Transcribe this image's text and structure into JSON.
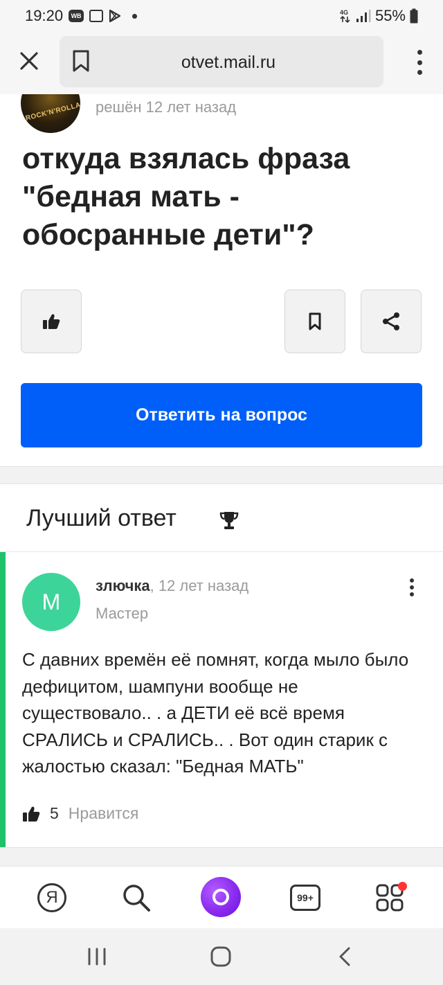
{
  "status_bar": {
    "time": "19:20",
    "wb_label": "WB",
    "battery": "55%",
    "icons": [
      "wb-app-icon",
      "gallery-icon",
      "play-store-icon",
      "notification-dot-icon",
      "network-4g-icon",
      "signal-icon",
      "battery-icon"
    ]
  },
  "browser": {
    "url": "otvet.mail.ru",
    "icons": [
      "close-icon",
      "bookmark-icon",
      "more-vertical-icon"
    ]
  },
  "question": {
    "status": "решён 12 лет назад",
    "title": "откуда взялась фраза \"бедная мать - обосранные дети\"?",
    "avatar_text": "ROCK'N'ROLLA",
    "answer_button": "Ответить на вопрос",
    "icons": [
      "thumbs-up-icon",
      "bookmark-icon",
      "share-icon"
    ]
  },
  "best_answer": {
    "heading": "Лучший ответ",
    "avatar_letter": "М",
    "author": "злючка",
    "time": ", 12 лет назад",
    "rank": "Мастер",
    "text": "С давних времён её помнят, когда мыло было дефицитом, шампуни вообще не существовало.. . а ДЕТИ её всё время СРАЛИСЬ и СРАЛИСЬ.. . Вот один старик с жалостью сказал: \"Бедная МАТЬ\"",
    "likes": "5",
    "like_label": "Нравится",
    "accent_color": "#1fc26a",
    "icons": [
      "trophy-icon",
      "more-vertical-icon",
      "thumbs-up-icon"
    ]
  },
  "bottom_nav": {
    "ya_label": "Я",
    "tabs_count": "99+",
    "icons": [
      "yandex-icon",
      "search-icon",
      "alice-icon",
      "tabs-icon",
      "services-icon"
    ]
  },
  "colors": {
    "primary": "#005ff9",
    "accent_green": "#1fc26a",
    "alice_purple": "#8a2bf0",
    "badge_red": "#ff3333"
  }
}
